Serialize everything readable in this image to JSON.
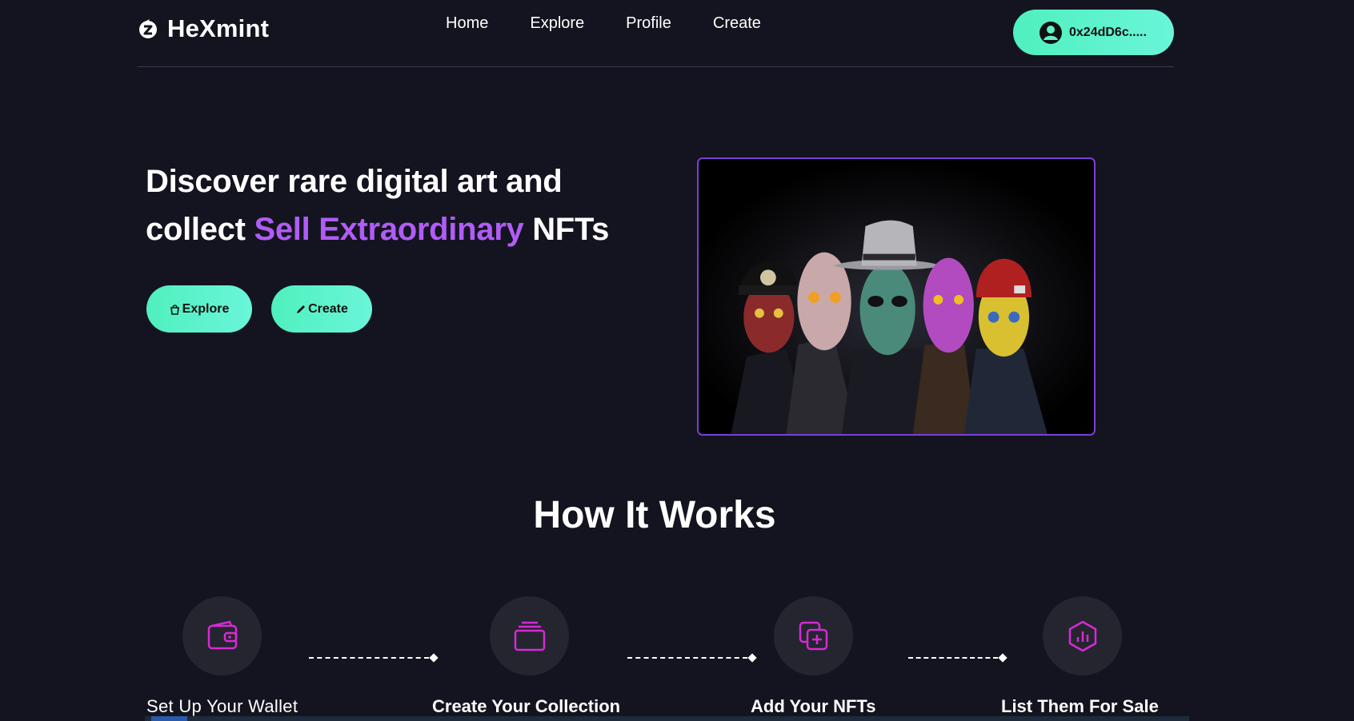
{
  "brand": {
    "name": "HeXmint",
    "logo_icon": "flame-logo-icon"
  },
  "nav": {
    "links": [
      {
        "label": "Home"
      },
      {
        "label": "Explore"
      },
      {
        "label": "Profile"
      },
      {
        "label": "Create"
      }
    ],
    "wallet": {
      "label": "0x24dD6c.....",
      "icon": "user-avatar-icon"
    }
  },
  "hero": {
    "title_part1": "Discover rare digital art and collect ",
    "title_highlight": "Sell Extraordinary",
    "title_part2": " NFTs",
    "explore_button": "Explore",
    "create_button": "Create",
    "colors": {
      "highlight": "#b05cf5",
      "button": "#4ff0be",
      "frame": "#7b3fd6"
    }
  },
  "how_it_works": {
    "title": "How It Works",
    "steps": [
      {
        "label": "Set Up Your Wallet",
        "icon": "wallet-icon"
      },
      {
        "label": "Create Your Collection",
        "icon": "collection-icon"
      },
      {
        "label": "Add Your NFTs",
        "icon": "add-nft-icon"
      },
      {
        "label": "List Them For Sale",
        "icon": "chart-hexagon-icon"
      }
    ],
    "icon_color": "#d62ad6"
  }
}
